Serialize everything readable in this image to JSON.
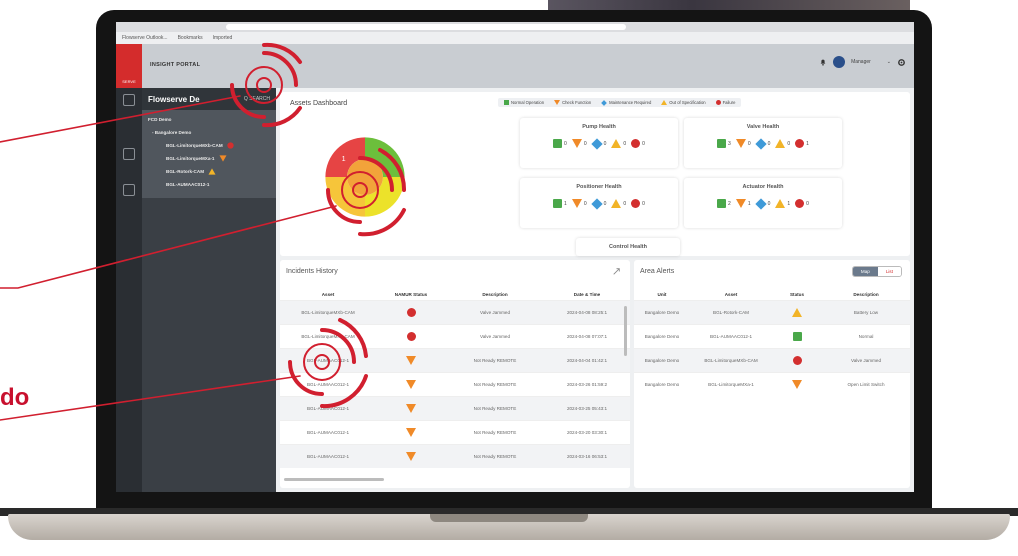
{
  "browser": {
    "bookmarks": [
      "Flowserve Outlook...",
      "Bookmarks",
      "Imported"
    ]
  },
  "header": {
    "logo_text": "SERVE",
    "portal_title": "INSIGHT PORTAL",
    "user_name": "Manager",
    "icons": [
      "bell-icon",
      "user-avatar",
      "chevron-down-icon",
      "settings-icon"
    ]
  },
  "sidebar": {
    "title": "Flowserve De",
    "search_label": "Q SEARCH",
    "items": [
      {
        "label": "FCD Demo",
        "level": 0,
        "badge": ""
      },
      {
        "label": "- Bangalore Demo",
        "level": 1,
        "badge": ""
      },
      {
        "label": "BGL-LimitorqueMXb-CAM",
        "level": 2,
        "badge": "error"
      },
      {
        "label": "BGL-LimitorqueMXa-1",
        "level": 2,
        "badge": "check"
      },
      {
        "label": "BGL-Rotork-CAM",
        "level": 2,
        "badge": "warning"
      },
      {
        "label": "BGL-AUMAAC012-1",
        "level": 2,
        "badge": ""
      }
    ]
  },
  "dashboard": {
    "title": "Assets Dashboard",
    "legend": [
      {
        "label": "Normal Operation",
        "color": "#4aa84a"
      },
      {
        "label": "Check Function",
        "color": "#f08a28"
      },
      {
        "label": "Maintenance Required",
        "color": "#3f9ad8"
      },
      {
        "label": "Out of Specification",
        "color": "#f2b428"
      },
      {
        "label": "Failure",
        "color": "#d32f2f"
      }
    ],
    "donut_label": "1",
    "health_cards": [
      {
        "title": "Pump Health",
        "counts": [
          "0",
          "0",
          "0",
          "0",
          "0"
        ]
      },
      {
        "title": "Valve Health",
        "counts": [
          "3",
          "0",
          "0",
          "0",
          "1"
        ]
      },
      {
        "title": "Positioner Health",
        "counts": [
          "1",
          "0",
          "0",
          "0",
          "0"
        ]
      },
      {
        "title": "Actuator Health",
        "counts": [
          "2",
          "1",
          "0",
          "1",
          "0"
        ]
      },
      {
        "title": "Control Health",
        "counts": []
      }
    ]
  },
  "incidents": {
    "title": "Incidents History",
    "columns": [
      "Asset",
      "NAMUR Status",
      "Description",
      "Date & Time"
    ],
    "rows": [
      {
        "asset": "BGL-LimitorqueMXb-CAM",
        "status": "failure",
        "description": "Valve Jammed",
        "datetime": "2024-04-08 08:25:1"
      },
      {
        "asset": "BGL-LimitorqueMXb-CAM",
        "status": "failure",
        "description": "Valve Jammed",
        "datetime": "2024-04-08 07:07:1"
      },
      {
        "asset": "BGL-AUMAAC012-1",
        "status": "check",
        "description": "Not Ready REMOTE",
        "datetime": "2024-04-04 01:42:1"
      },
      {
        "asset": "BGL-AUMAAC012-1",
        "status": "check",
        "description": "Not Ready REMOTE",
        "datetime": "2024-03-26 01:59:2"
      },
      {
        "asset": "BGL-AUMAAC012-1",
        "status": "check",
        "description": "Not Ready REMOTE",
        "datetime": "2024-03-25 05:43:1"
      },
      {
        "asset": "BGL-AUMAAC012-1",
        "status": "check",
        "description": "Not Ready REMOTE",
        "datetime": "2024-03-20 03:30:1"
      },
      {
        "asset": "BGL-AUMAAC012-1",
        "status": "check",
        "description": "Not Ready REMOTE",
        "datetime": "2024-03-16 06:53:1"
      }
    ]
  },
  "area_alerts": {
    "title": "Area Alerts",
    "toggle": [
      "Map",
      "List"
    ],
    "columns": [
      "Unit",
      "Asset",
      "Status",
      "Description"
    ],
    "rows": [
      {
        "unit": "Bangalore Demo",
        "asset": "BGL-Rotork-CAM",
        "status": "warning",
        "description": "Battery Low"
      },
      {
        "unit": "Bangalore Demo",
        "asset": "BGL-AUMAAC012-1",
        "status": "normal",
        "description": "Normal"
      },
      {
        "unit": "Bangalore Demo",
        "asset": "BGL-LimitorqueMXb-CAM",
        "status": "failure",
        "description": "Valve Jammed"
      },
      {
        "unit": "Bangalore Demo",
        "asset": "BGL-LimitorqueMXa-1",
        "status": "check",
        "description": "Open Limit Switch"
      }
    ]
  },
  "callouts": [
    {
      "text": "",
      "color": "#c8102e"
    },
    {
      "text": "",
      "color": "#c8102e"
    },
    {
      "text": "do",
      "color": "#c8102e"
    }
  ]
}
